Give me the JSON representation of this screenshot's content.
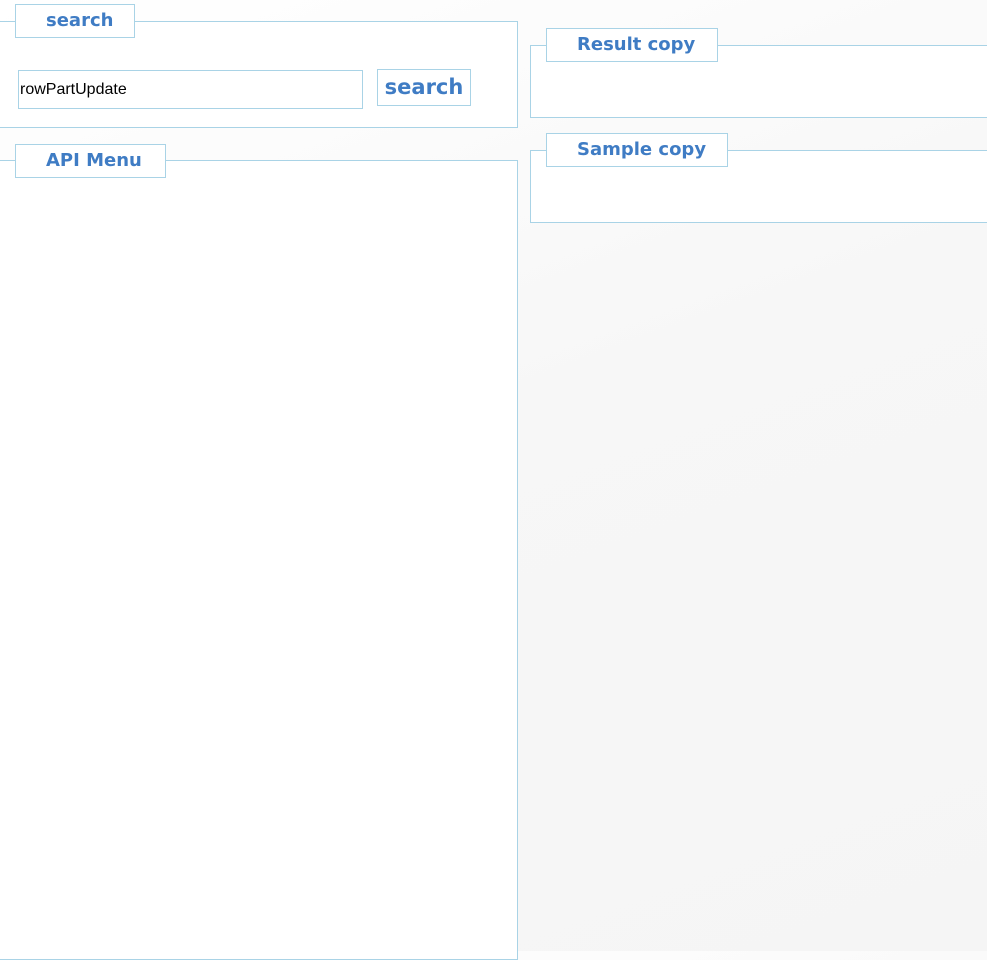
{
  "search_section": {
    "legend": "search",
    "input_value": "rowPartUpdate",
    "button_label": "search"
  },
  "api_menu_section": {
    "legend": "API Menu",
    "items": []
  },
  "result_section": {
    "legend": "Result copy"
  },
  "sample_section": {
    "legend": "Sample copy"
  },
  "colors": {
    "accent": "#3f7cc4",
    "border": "#a9d3e6",
    "panel_background": "#ffffff",
    "page_background": "#f6f6f6"
  }
}
